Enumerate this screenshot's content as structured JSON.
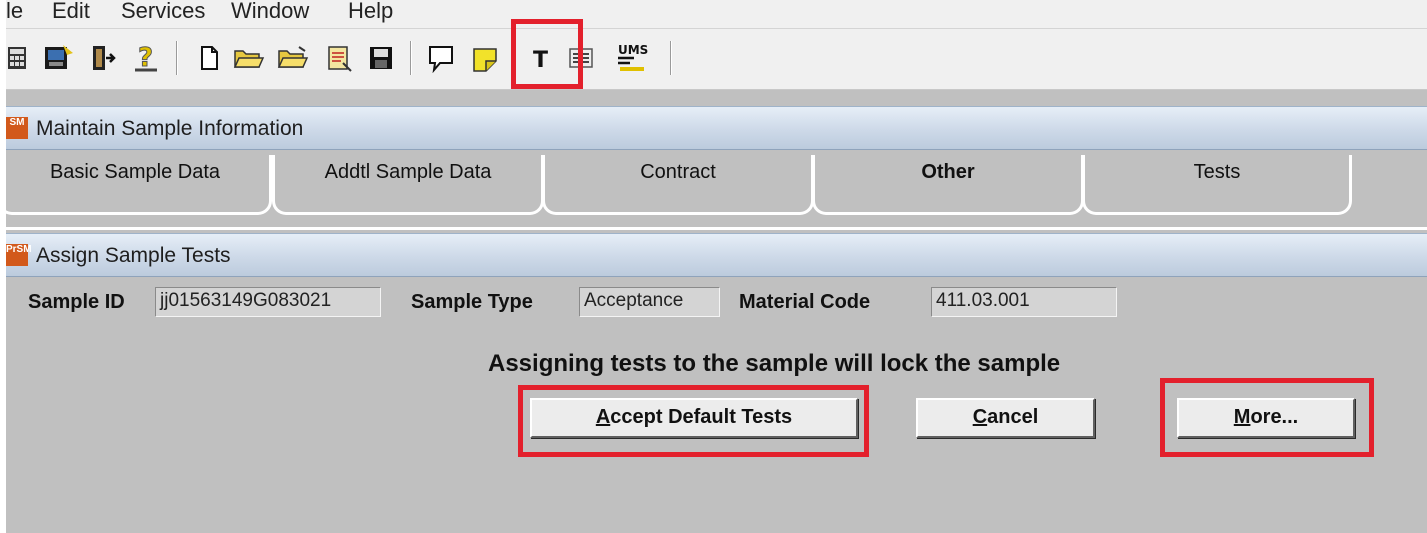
{
  "menu": {
    "items": [
      "le",
      "Edit",
      "Services",
      "Window",
      "Help"
    ]
  },
  "toolbar": {
    "buttons": [
      "calculator-icon",
      "tools-icon",
      "exit-icon",
      "help-icon",
      "new-document-icon",
      "open-folder-icon",
      "open-folder-alt-icon",
      "notepad-icon",
      "save-icon",
      "comment-icon",
      "sticky-note-icon",
      "tests-t-icon",
      "list-icon",
      "ums-icon"
    ],
    "tests_label": "T",
    "ums_label": "UMS"
  },
  "maintain_window": {
    "title": "Maintain Sample Information",
    "icon_text": "SM"
  },
  "tabs": [
    {
      "label": "Basic Sample Data",
      "active": false
    },
    {
      "label": "Addtl Sample Data",
      "active": false
    },
    {
      "label": "Contract",
      "active": false
    },
    {
      "label": "Other",
      "active": true
    },
    {
      "label": "Tests",
      "active": false
    }
  ],
  "assign_window": {
    "title": "Assign Sample Tests",
    "icon_text": "PrSM"
  },
  "fields": {
    "sample_id_label": "Sample ID",
    "sample_id_value": "jj01563149G083021",
    "sample_type_label": "Sample Type",
    "sample_type_value": "Acceptance",
    "material_code_label": "Material Code",
    "material_code_value": "411.03.001"
  },
  "notice": "Assigning tests to the sample will lock the sample",
  "buttons": {
    "accept": {
      "mnemonic": "A",
      "rest": "ccept Default Tests"
    },
    "cancel": {
      "mnemonic": "C",
      "rest": "ancel"
    },
    "more": {
      "mnemonic": "M",
      "rest": "ore..."
    }
  },
  "colors": {
    "highlight": "#e3202c",
    "window_bg": "#c0c0c0",
    "titlebar": "#cdd9e8",
    "icon_orange": "#d2591b"
  }
}
